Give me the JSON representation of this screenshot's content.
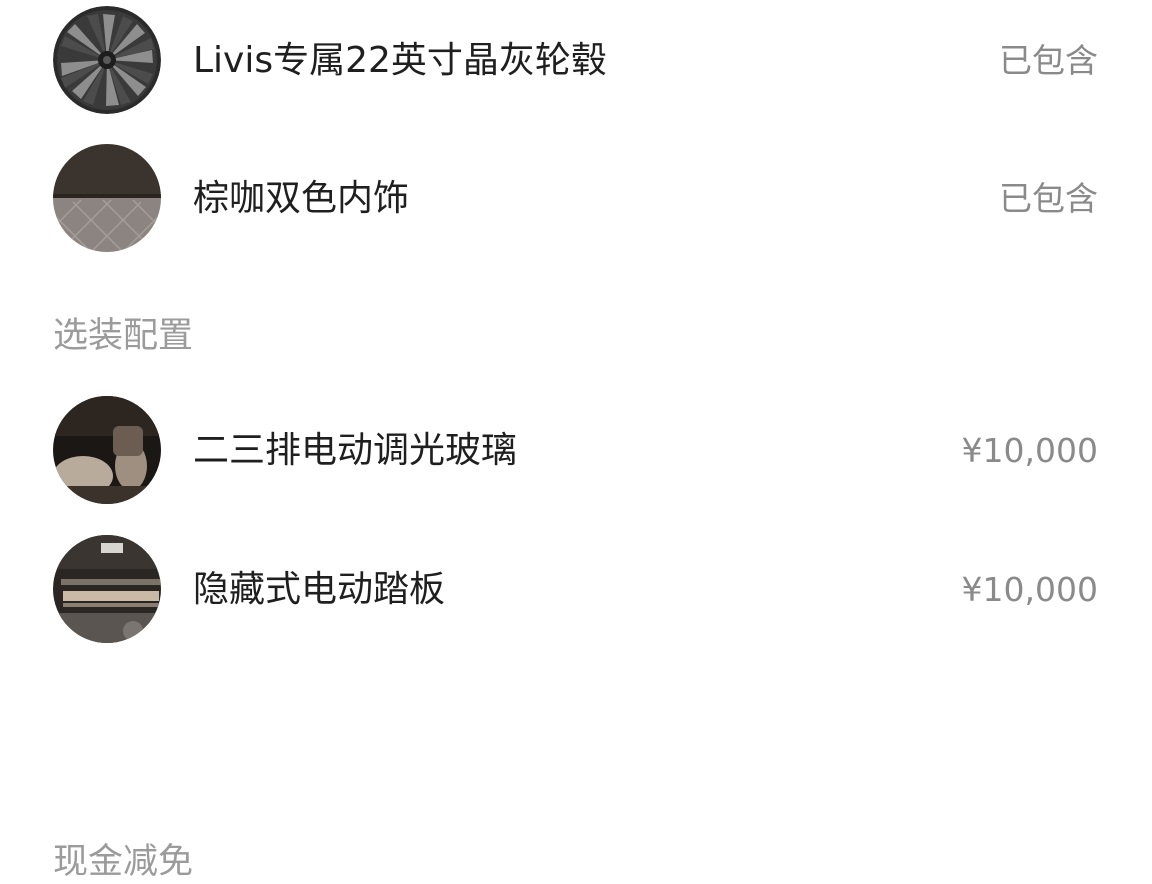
{
  "included": {
    "items": [
      {
        "name": "Livis专属22英寸晶灰轮毂",
        "status": "已包含",
        "thumbnail": "wheel-icon"
      },
      {
        "name": "棕咖双色内饰",
        "status": "已包含",
        "thumbnail": "interior-icon"
      }
    ]
  },
  "optional_section": {
    "title": "选装配置",
    "items": [
      {
        "name": "二三排电动调光玻璃",
        "price": "¥10,000",
        "thumbnail": "glass-icon"
      },
      {
        "name": "隐藏式电动踏板",
        "price": "¥10,000",
        "thumbnail": "step-icon"
      }
    ]
  },
  "discount_section": {
    "title": "现金减免"
  },
  "colors": {
    "primary_text": "#1f1f1f",
    "secondary_text": "#8a8a8a",
    "section_title": "#9b9b9b"
  }
}
